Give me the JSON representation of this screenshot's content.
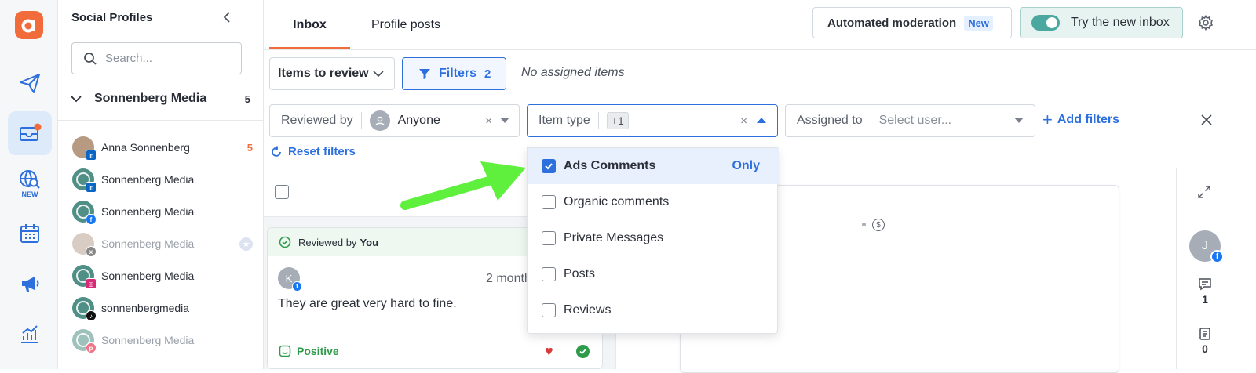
{
  "rail": {
    "new_badge": "NEW",
    "brand_color": "#f26b3a",
    "accent": "#2d6fdc"
  },
  "profiles": {
    "title": "Social Profiles",
    "search_placeholder": "Search...",
    "group": {
      "name": "Sonnenberg Media",
      "count": "5"
    },
    "items": [
      {
        "name": "Anna Sonnenberg",
        "network": "linkedin",
        "badge": "5"
      },
      {
        "name": "Sonnenberg Media",
        "network": "linkedin"
      },
      {
        "name": "Sonnenberg Media",
        "network": "facebook"
      },
      {
        "name": "Sonnenberg Media",
        "network": "x"
      },
      {
        "name": "Sonnenberg Media",
        "network": "instagram"
      },
      {
        "name": "sonnenbergmedia",
        "network": "tiktok"
      },
      {
        "name": "Sonnenberg Media",
        "network": "pinterest"
      }
    ]
  },
  "header": {
    "tab_inbox": "Inbox",
    "tab_profile_posts": "Profile posts",
    "automated_moderation": "Automated moderation",
    "new_label": "New",
    "try_new_inbox": "Try the new inbox"
  },
  "toolbar": {
    "view_select": "Items to review",
    "filters_label": "Filters",
    "filters_count": "2",
    "no_assigned": "No assigned items"
  },
  "filters": {
    "reviewed_by_label": "Reviewed by",
    "reviewed_by_value": "Anyone",
    "item_type_label": "Item type",
    "item_type_extra": "+1",
    "assigned_to_label": "Assigned to",
    "assigned_to_placeholder": "Select user...",
    "add_filters": "Add filters",
    "reset_filters": "Reset filters"
  },
  "dropdown": {
    "only_label": "Only",
    "options": [
      {
        "label": "Ads Comments",
        "checked": true
      },
      {
        "label": "Organic comments",
        "checked": false
      },
      {
        "label": "Private Messages",
        "checked": false
      },
      {
        "label": "Posts",
        "checked": false
      },
      {
        "label": "Reviews",
        "checked": false
      }
    ]
  },
  "card": {
    "reviewed_prefix": "Reviewed by",
    "reviewed_user": "You",
    "time": "2 month",
    "text": "They are great very hard to fine.",
    "sentiment": "Positive"
  },
  "right_panel": {
    "comments_count": "1",
    "notes_count": "0",
    "avatar_initial": "J"
  }
}
